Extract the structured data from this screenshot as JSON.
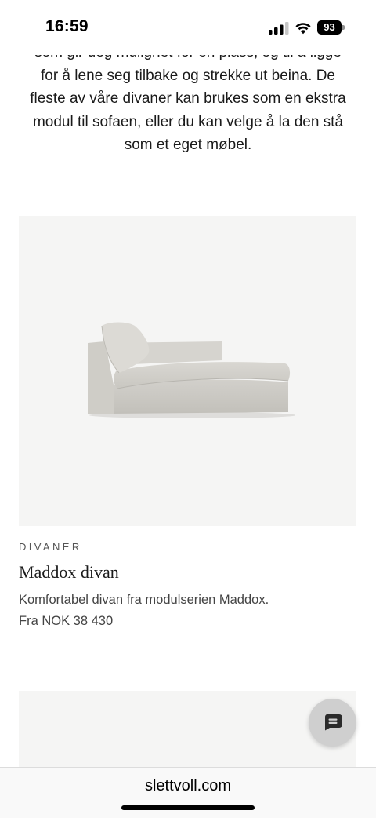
{
  "status_bar": {
    "time": "16:59",
    "battery_level": "93",
    "icons": [
      "signal-icon",
      "wifi-icon",
      "battery-icon"
    ]
  },
  "intro": {
    "line_partial": "som gir deg mulighet for en plass, og til å ligge",
    "lines": [
      "for å lene seg tilbake og strekke ut beina. De",
      "fleste av våre divaner kan brukes som en ekstra",
      "modul til sofaen, eller du kan velge å la den stå",
      "som et eget møbel."
    ]
  },
  "product": {
    "category": "DIVANER",
    "name": "Maddox divan",
    "description": "Komfortabel divan fra modulserien Maddox.",
    "price": "Fra NOK 38 430",
    "image_icon": "sofa-image"
  },
  "chat": {
    "icon": "chat-icon"
  },
  "browser": {
    "url": "slettvoll.com"
  },
  "colors": {
    "card_background": "#f5f5f4",
    "fab_background": "#cfcfcf",
    "text_primary": "#1a1a1a",
    "text_secondary": "#444444"
  }
}
